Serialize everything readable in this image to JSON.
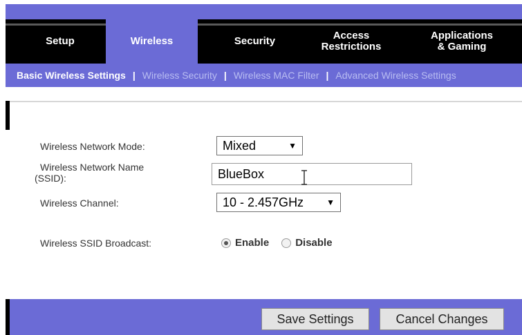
{
  "top_tabs": [
    {
      "label": "Setup",
      "active": false
    },
    {
      "label": "Wireless",
      "active": true
    },
    {
      "label": "Security",
      "active": false
    },
    {
      "label_line1": "Access",
      "label_line2": "Restrictions",
      "active": false
    },
    {
      "label_line1": "Applications",
      "label_line2": "& Gaming",
      "active": false
    }
  ],
  "sub_tabs": {
    "items": [
      {
        "label": "Basic Wireless Settings",
        "active": true
      },
      {
        "label": "Wireless Security",
        "active": false
      },
      {
        "label": "Wireless MAC Filter",
        "active": false
      },
      {
        "label": "Advanced Wireless Settings",
        "active": false
      }
    ],
    "separator": "|"
  },
  "form": {
    "network_mode": {
      "label": "Wireless Network Mode:",
      "value": "Mixed"
    },
    "network_name": {
      "label_line1": "Wireless Network Name",
      "label_line2": "(SSID):",
      "value": "BlueBox"
    },
    "channel": {
      "label": "Wireless Channel:",
      "value": "10 - 2.457GHz"
    },
    "ssid_broadcast": {
      "label": "Wireless SSID Broadcast:",
      "options": [
        {
          "label": "Enable",
          "selected": true
        },
        {
          "label": "Disable",
          "selected": false
        }
      ]
    }
  },
  "buttons": {
    "save": "Save Settings",
    "cancel": "Cancel Changes"
  },
  "icons": {
    "dropdown_arrow": "▼"
  },
  "colors": {
    "accent": "#6b6bd6",
    "dark": "#000000",
    "subtab_inactive": "#b9bdf2"
  }
}
